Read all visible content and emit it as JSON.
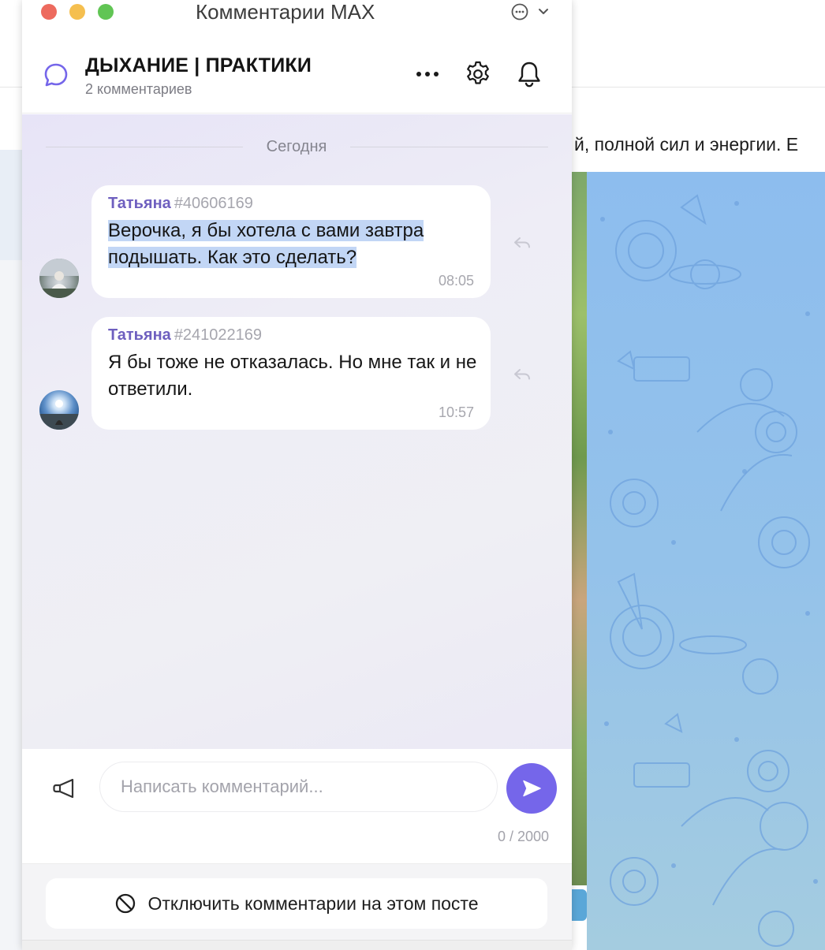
{
  "window": {
    "title": "Комментарии MAX"
  },
  "header": {
    "channel_name": "ДЫХАНИЕ | ПРАКТИКИ",
    "comments_count": "2 комментариев"
  },
  "chat": {
    "date_separator": "Сегодня",
    "messages": [
      {
        "author": "Татьяна",
        "author_id": "#40606169",
        "text": "Верочка, я бы хотела с вами завтра подышать. Как это сделать?",
        "time": "08:05",
        "selected": true
      },
      {
        "author": "Татьяна",
        "author_id": "#241022169",
        "text": "Я бы тоже не отказалась. Но мне так и не ответили.",
        "time": "10:57",
        "selected": false
      }
    ]
  },
  "composer": {
    "placeholder": "Написать комментарий...",
    "value": "",
    "char_counter": "0 / 2000"
  },
  "footer": {
    "disable_label": "Отключить комментарии на этом посте"
  },
  "background": {
    "text_fragment": "й, полной сил и энергии. Е"
  },
  "colors": {
    "accent": "#7566ea",
    "author": "#6e5fbf",
    "selection": "#c2d6f5",
    "traffic_red": "#ed6a5e",
    "traffic_yellow": "#f5bf4f",
    "traffic_green": "#61c554"
  },
  "icons": {
    "channel": "comment-bubble-icon",
    "more": "more-horizontal-icon",
    "settings": "gear-icon",
    "notifications": "bell-icon",
    "reply": "reply-arrow-icon",
    "announce": "megaphone-icon",
    "send": "send-arrow-icon",
    "disable": "prohibited-icon"
  }
}
